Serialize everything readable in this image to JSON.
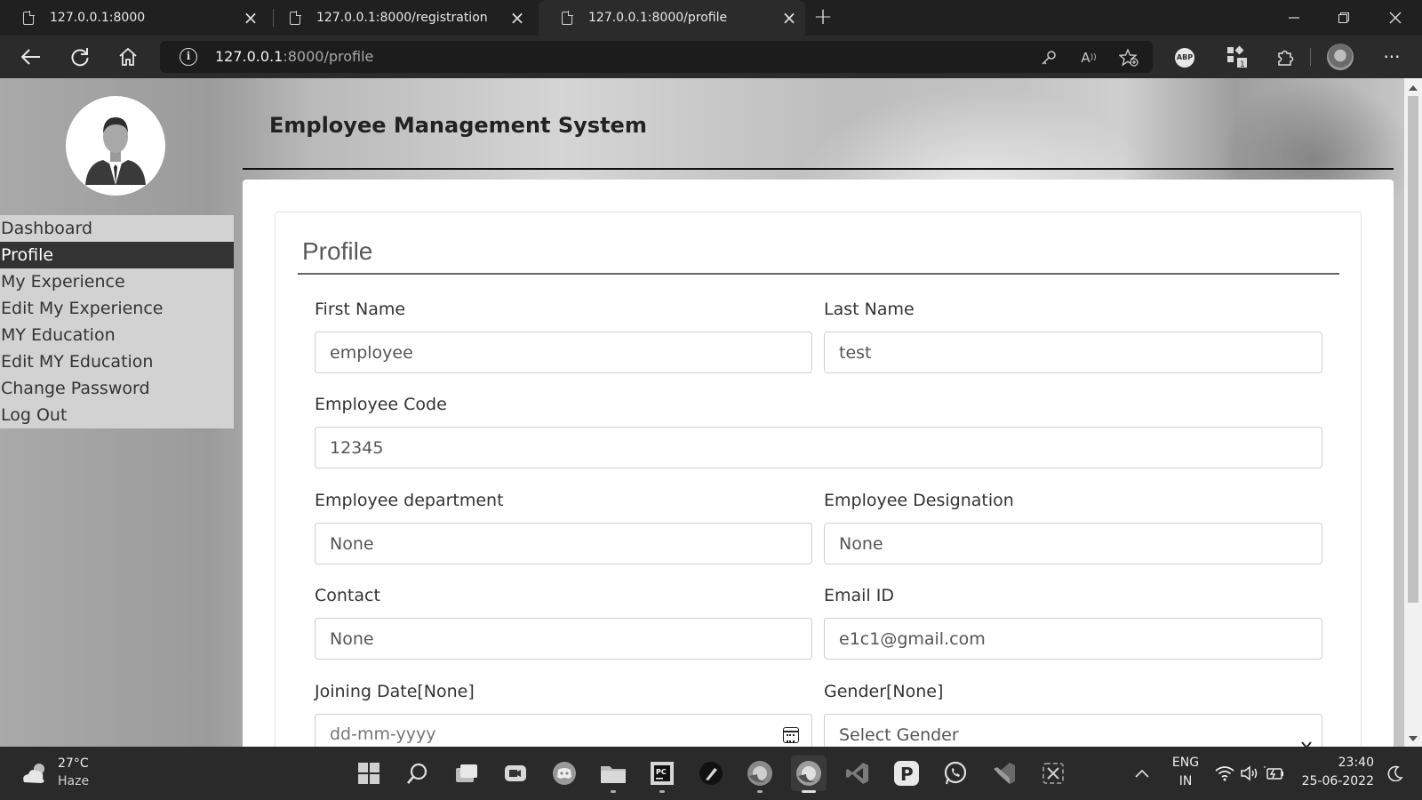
{
  "browser": {
    "tabs": [
      {
        "title": "127.0.0.1:8000",
        "active": false
      },
      {
        "title": "127.0.0.1:8000/registration",
        "active": false
      },
      {
        "title": "127.0.0.1:8000/profile",
        "active": true
      }
    ],
    "url_host": "127.0.0.1",
    "url_rest": ":8000/profile",
    "extension_abp_label": "ABP",
    "extension_badge": "1"
  },
  "sidebar": {
    "items": [
      {
        "label": "Dashboard"
      },
      {
        "label": "Profile"
      },
      {
        "label": "My Experience"
      },
      {
        "label": "Edit My Experience"
      },
      {
        "label": "MY Education"
      },
      {
        "label": "Edit MY Education"
      },
      {
        "label": "Change Password"
      },
      {
        "label": "Log Out"
      }
    ],
    "active_index": 1
  },
  "header": {
    "title": "Employee Management System"
  },
  "profile": {
    "title": "Profile",
    "first_name": {
      "label": "First Name",
      "value": "employee"
    },
    "last_name": {
      "label": "Last Name",
      "value": "test"
    },
    "employee_code": {
      "label": "Employee Code",
      "value": "12345"
    },
    "department": {
      "label": "Employee department",
      "value": "None"
    },
    "designation": {
      "label": "Employee Designation",
      "value": "None"
    },
    "contact": {
      "label": "Contact",
      "value": "None"
    },
    "email": {
      "label": "Email ID",
      "value": "e1c1@gmail.com"
    },
    "joining_date": {
      "label": "Joining Date[None]",
      "placeholder": "dd-mm-yyyy"
    },
    "gender": {
      "label": "Gender[None]",
      "selected": "Select Gender"
    }
  },
  "taskbar": {
    "weather_temp": "27°C",
    "weather_desc": "Haze",
    "language_top": "ENG",
    "language_bottom": "IN",
    "time": "23:40",
    "date": "25-06-2022"
  }
}
